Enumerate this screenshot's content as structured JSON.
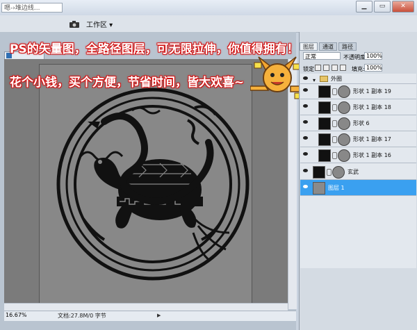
{
  "topbar": {
    "search_text": "嗯-›堆边线...",
    "workspace_label": "工作区 ▾",
    "win_buttons": [
      "▁",
      "▭",
      "✕"
    ]
  },
  "promo": {
    "line1": "PS的矢量图，全路径图层，可无限拉伸，你值得拥有！",
    "line2": "花个小钱，买个方便，节省时间，皆大欢喜~"
  },
  "document": {
    "zoom": "16.67%",
    "info": "文档:27.8M/0 字节",
    "arrow": "▶"
  },
  "panel": {
    "tabs": [
      "图层",
      "通道",
      "路径"
    ],
    "blend_mode": "正常",
    "opacity_label": "不透明度:",
    "opacity_value": "100%",
    "lock_label": "锁定:",
    "fill_label": "填充:",
    "fill_value": "100%",
    "group_name": "外圈",
    "layers": [
      {
        "name": "形状 1 副本 19"
      },
      {
        "name": "形状 1 副本 18"
      },
      {
        "name": "形状 6"
      },
      {
        "name": "形状 1 副本 17"
      },
      {
        "name": "形状 1 副本 16"
      },
      {
        "name": "玄武"
      },
      {
        "name": "图层 1"
      }
    ]
  },
  "colors": {
    "selected_layer": "#3aa0f0",
    "promo_outline": "#d31414",
    "artwork_bg": "#888888"
  }
}
